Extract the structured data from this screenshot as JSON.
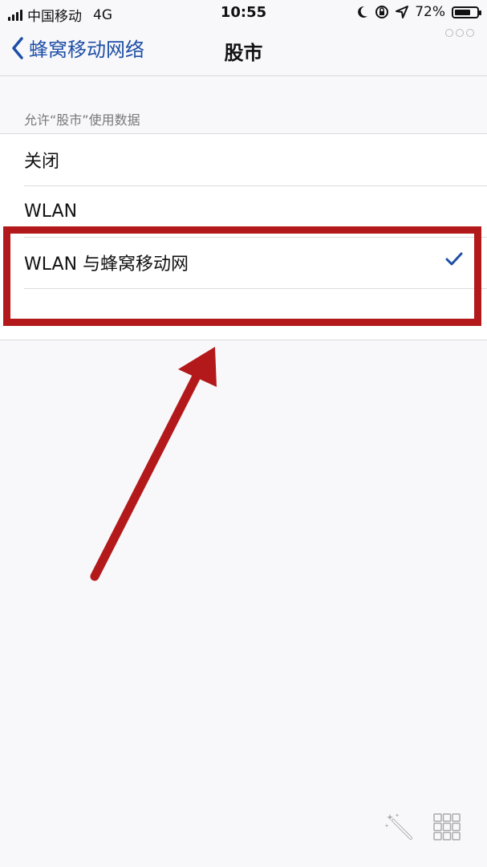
{
  "status_bar": {
    "carrier": "中国移动",
    "network": "4G",
    "time": "10:55",
    "battery": "72%",
    "battery_level": 0.72,
    "icons": [
      "signal-icon",
      "moon-icon",
      "orientation-lock-icon",
      "location-icon",
      "battery-icon"
    ]
  },
  "nav": {
    "back_label": "蜂窝移动网络",
    "title": "股市"
  },
  "section": {
    "header": "允许“股市”使用数据",
    "options": [
      {
        "label": "关闭",
        "selected": false
      },
      {
        "label": "WLAN",
        "selected": false
      },
      {
        "label": "WLAN 与蜂窝移动网",
        "selected": true
      }
    ]
  },
  "colors": {
    "accent": "#1e4fa6",
    "annotation": "#b3191a",
    "background": "#f8f8fb"
  },
  "bottom_icons": [
    "magic-wand-icon",
    "grid-icon"
  ]
}
